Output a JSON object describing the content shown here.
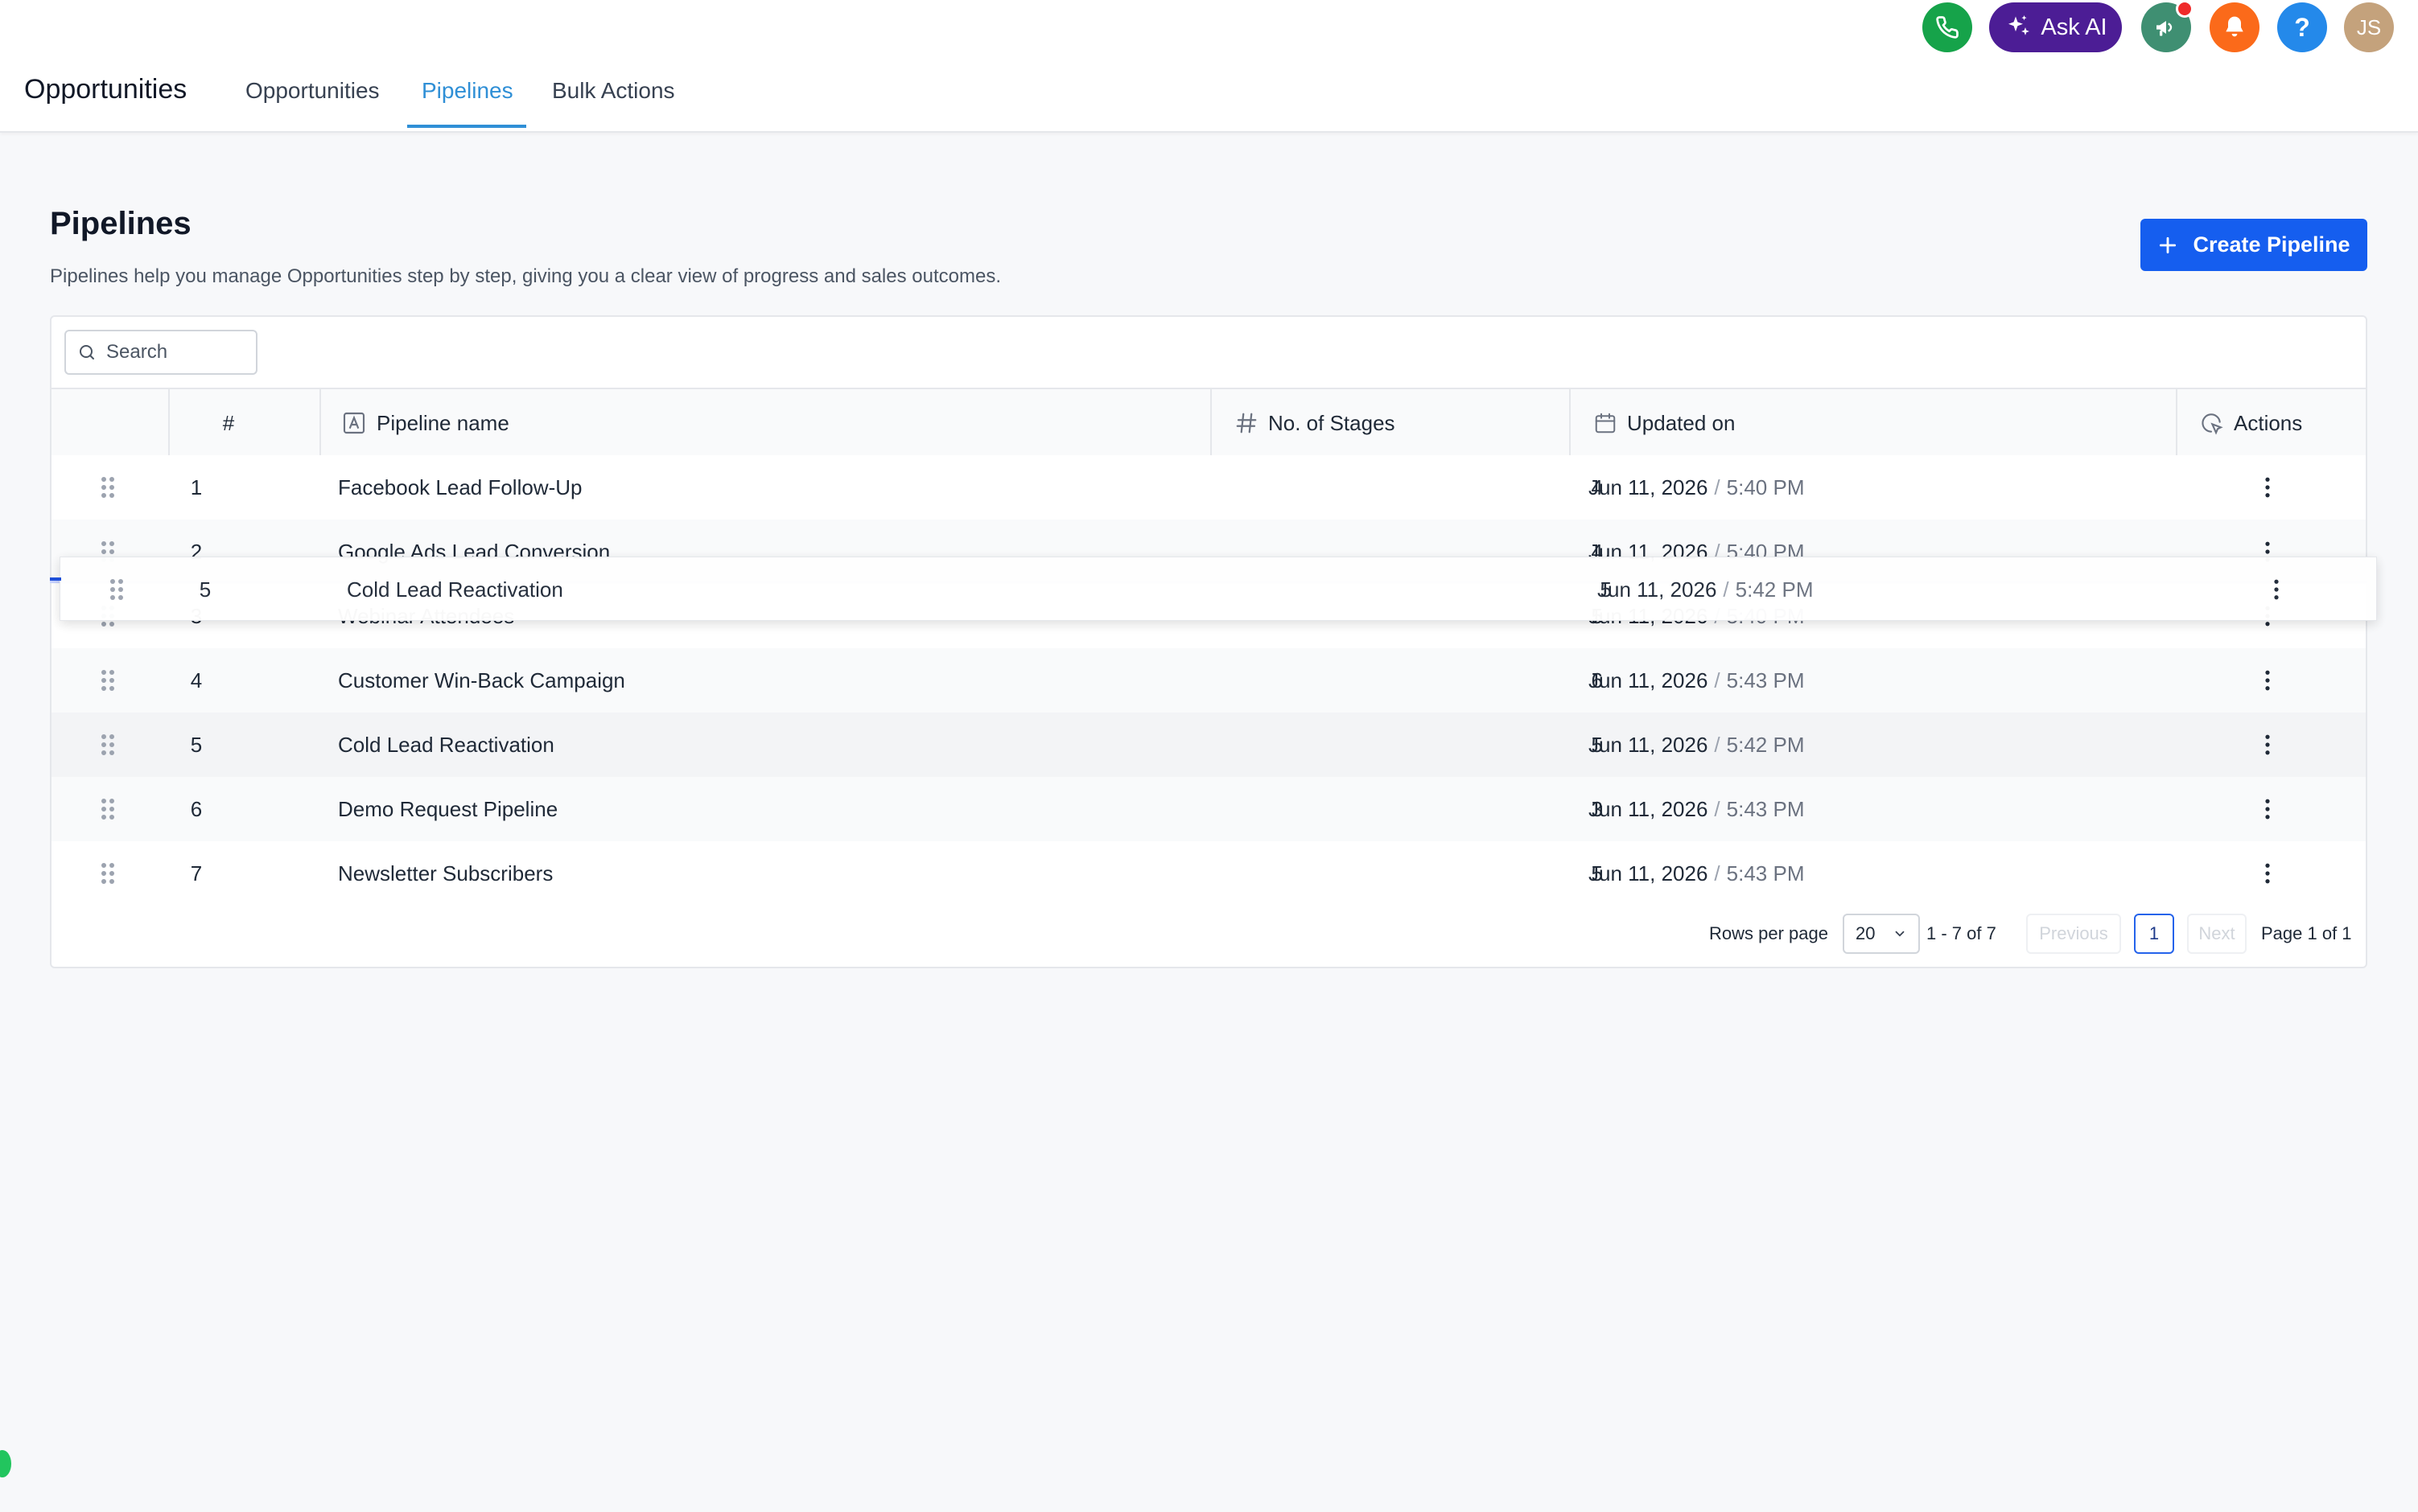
{
  "header": {
    "app_title": "Opportunities",
    "tabs": [
      {
        "label": "Opportunities",
        "active": false
      },
      {
        "label": "Pipelines",
        "active": true
      },
      {
        "label": "Bulk Actions",
        "active": false
      }
    ],
    "ask_ai_label": "Ask AI",
    "help_label": "?",
    "avatar_initials": "JS",
    "accent_color": "#2f8fd6"
  },
  "page": {
    "title": "Pipelines",
    "description": "Pipelines help you manage Opportunities step by step, giving you a clear view of progress and sales outcomes.",
    "create_button_label": "Create Pipeline"
  },
  "search": {
    "placeholder": "Search",
    "value": ""
  },
  "table": {
    "columns": {
      "index": "#",
      "name": "Pipeline name",
      "stages": "No. of Stages",
      "updated": "Updated on",
      "actions": "Actions"
    },
    "rows": [
      {
        "num": "1",
        "name": "Facebook Lead Follow-Up",
        "stages": "4",
        "date": "Jun 11, 2026",
        "sep": "/",
        "time": "5:40 PM"
      },
      {
        "num": "2",
        "name": "Google Ads Lead Conversion",
        "stages": "4",
        "date": "Jun 11, 2026",
        "sep": "/",
        "time": "5:40 PM"
      },
      {
        "num": "3",
        "name": "Webinar Attendees",
        "stages": "5",
        "date": "Jun 11, 2026",
        "sep": "/",
        "time": "5:40 PM"
      },
      {
        "num": "4",
        "name": "Customer Win-Back Campaign",
        "stages": "6",
        "date": "Jun 11, 2026",
        "sep": "/",
        "time": "5:43 PM"
      },
      {
        "num": "5",
        "name": "Cold Lead Reactivation",
        "stages": "5",
        "date": "Jun 11, 2026",
        "sep": "/",
        "time": "5:42 PM"
      },
      {
        "num": "6",
        "name": "Demo Request Pipeline",
        "stages": "3",
        "date": "Jun 11, 2026",
        "sep": "/",
        "time": "5:43 PM"
      },
      {
        "num": "7",
        "name": "Newsletter Subscribers",
        "stages": "5",
        "date": "Jun 11, 2026",
        "sep": "/",
        "time": "5:43 PM"
      }
    ],
    "dragging_row": {
      "num": "5",
      "name": "Cold Lead Reactivation",
      "stages": "5",
      "date": "Jun 11, 2026",
      "sep": "/",
      "time": "5:42 PM"
    }
  },
  "pagination": {
    "rows_per_page_label": "Rows per page",
    "rows_per_page_value": "20",
    "range_text": "1 - 7 of 7",
    "previous_label": "Previous",
    "current_page": "1",
    "next_label": "Next",
    "page_info": "Page 1 of 1"
  },
  "icons": [
    "phone-icon",
    "sparkle-icon",
    "megaphone-icon",
    "bell-icon",
    "search-icon",
    "text-field-icon",
    "hash-icon",
    "calendar-icon",
    "cursor-click-icon",
    "drag-handle-icon",
    "more-vertical-icon",
    "plus-icon",
    "chevron-down-icon"
  ]
}
